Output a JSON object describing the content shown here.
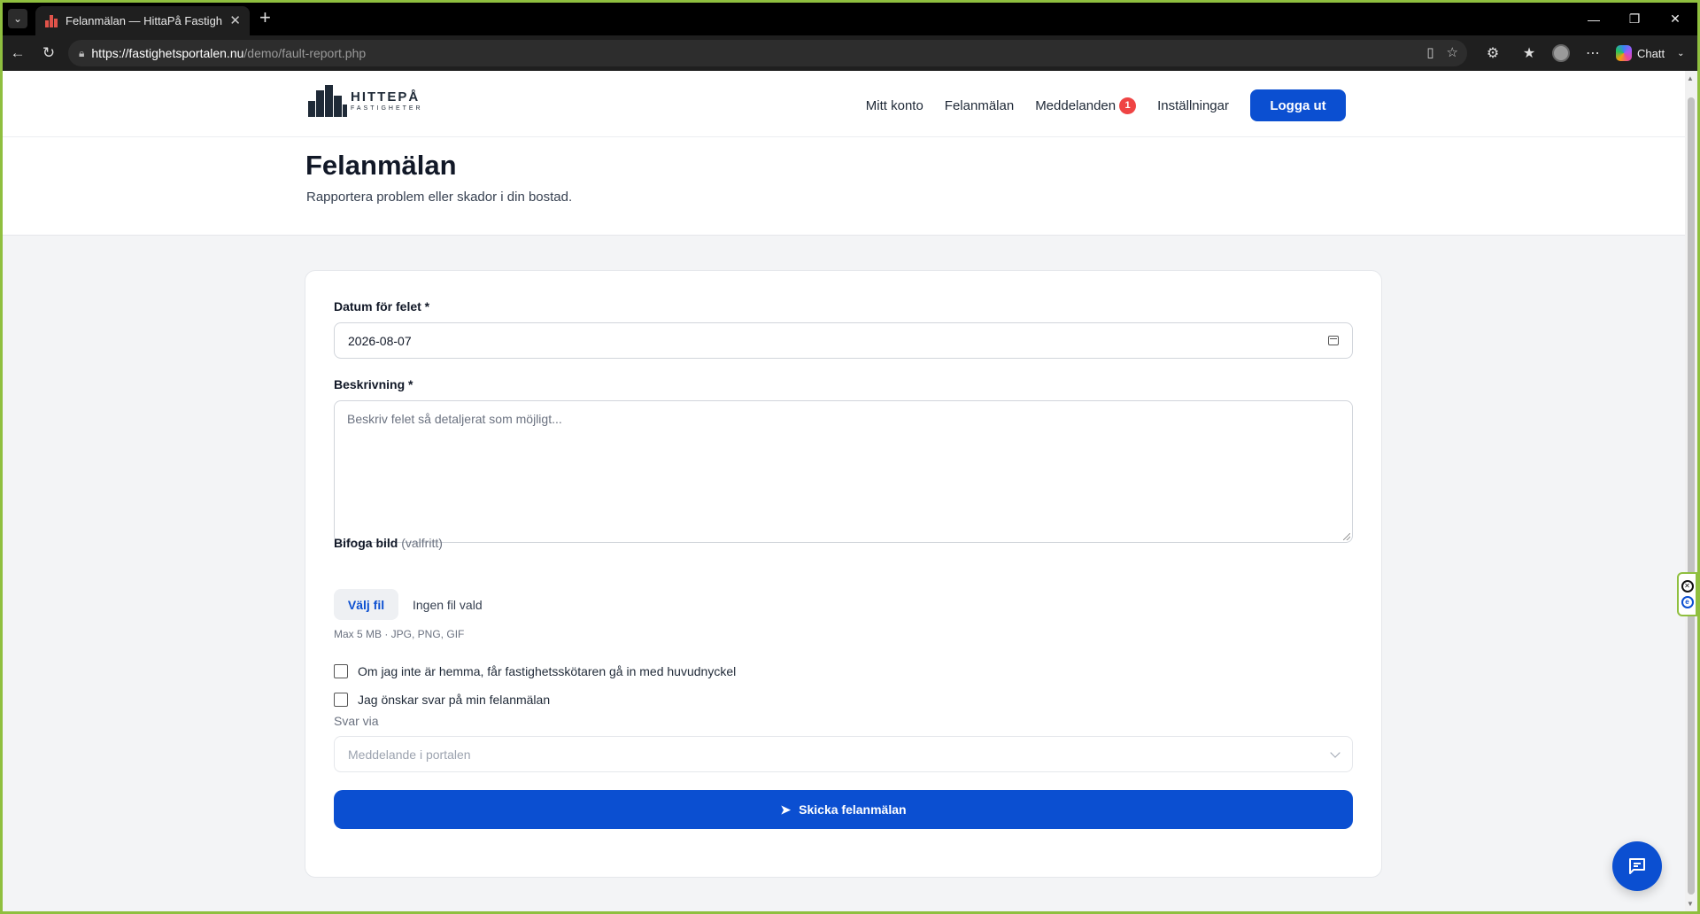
{
  "browser": {
    "tab_title": "Felanmälan — HittaPå Fastigheter",
    "url_host": "https://fastighetsportalen.nu",
    "url_path": "/demo/fault-report.php",
    "copilot_label": "Chatt"
  },
  "header": {
    "logo_name": "HITTEPÅ",
    "logo_sub": "FASTIGHETER",
    "nav": [
      {
        "label": "Mitt konto"
      },
      {
        "label": "Felanmälan"
      },
      {
        "label": "Meddelanden",
        "badge": "1"
      },
      {
        "label": "Inställningar"
      }
    ],
    "logout_label": "Logga ut"
  },
  "page": {
    "title": "Felanmälan",
    "subtitle": "Rapportera problem eller skador i din bostad."
  },
  "form": {
    "date_label": "Datum för felet *",
    "date_value": "2026-08-07",
    "description_label": "Beskrivning *",
    "description_placeholder": "Beskriv felet så detaljerat som möjligt...",
    "attach_label": "Bifoga bild",
    "attach_optional": "(valfritt)",
    "file_button": "Välj fil",
    "file_status": "Ingen fil vald",
    "file_hint": "Max 5 MB · JPG, PNG, GIF",
    "checkbox_master_key": "Om jag inte är hemma, får fastighetsskötaren gå in med huvudnyckel",
    "checkbox_reply": "Jag önskar svar på min felanmälan",
    "reply_via_label": "Svar via",
    "reply_via_value": "Meddelande i portalen",
    "submit_label": "Skicka felanmälan"
  },
  "colors": {
    "primary": "#0b4fd1",
    "badge": "#ef4444",
    "page_bg": "#f3f4f6"
  }
}
